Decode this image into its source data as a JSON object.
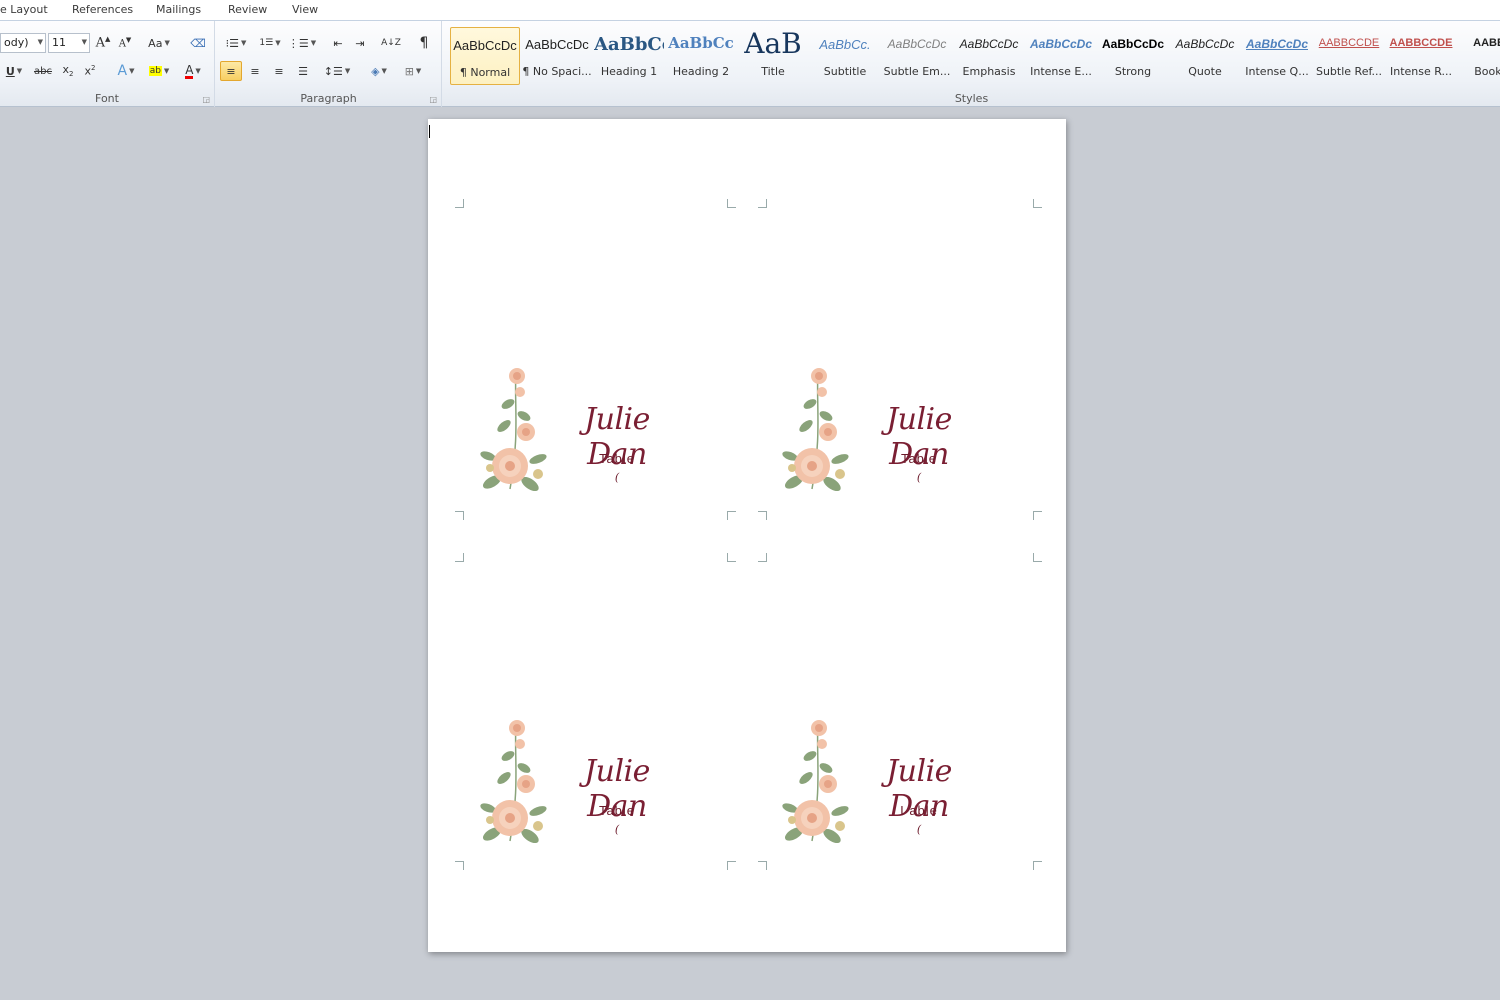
{
  "tabs": [
    "e Layout",
    "References",
    "Mailings",
    "Review",
    "View"
  ],
  "font": {
    "font_name": "ody)",
    "font_size": "11",
    "group_label": "Font"
  },
  "paragraph": {
    "group_label": "Paragraph",
    "pilcrow": "¶"
  },
  "styles": {
    "group_label": "Styles",
    "items": [
      {
        "sample": "AaBbCcDc",
        "name": "¶ Normal",
        "color": "#222222"
      },
      {
        "sample": "AaBbCcDc",
        "name": "¶ No Spaci...",
        "color": "#222222"
      },
      {
        "sample": "AaBbCc",
        "name": "Heading 1",
        "color": "#2a5783"
      },
      {
        "sample": "AaBbCc",
        "name": "Heading 2",
        "color": "#4f81bd"
      },
      {
        "sample": "AaB",
        "name": "Title",
        "color": "#17365d"
      },
      {
        "sample": "AaBbCc.",
        "name": "Subtitle",
        "color": "#4f81bd"
      },
      {
        "sample": "AaBbCcDc",
        "name": "Subtle Em...",
        "color": "#7f7f7f"
      },
      {
        "sample": "AaBbCcDc",
        "name": "Emphasis",
        "color": "#222222"
      },
      {
        "sample": "AaBbCcDc",
        "name": "Intense E...",
        "color": "#4f81bd"
      },
      {
        "sample": "AaBbCcDc",
        "name": "Strong",
        "color": "#000000"
      },
      {
        "sample": "AaBbCcDc",
        "name": "Quote",
        "color": "#222222"
      },
      {
        "sample": "AaBbCcDc",
        "name": "Intense Q...",
        "color": "#4f81bd"
      },
      {
        "sample": "AABBCCDE",
        "name": "Subtle Ref...",
        "color": "#c0504d"
      },
      {
        "sample": "AABBCCDE",
        "name": "Intense R...",
        "color": "#c0504d"
      },
      {
        "sample": "AABBC",
        "name": "Book T",
        "color": "#222222"
      }
    ]
  },
  "cards": [
    {
      "name": "Julie Dan",
      "table": "Table",
      "number": "("
    },
    {
      "name": "Julie Dan",
      "table": "Table",
      "number": "("
    },
    {
      "name": "Julie Dan",
      "table": "Table",
      "number": "("
    },
    {
      "name": "Julie Dan",
      "table": "I able",
      "number": "("
    }
  ],
  "colors": {
    "name_color": "#7a1f33",
    "petal": "#f2c2a8",
    "leaf": "#8aa37a"
  }
}
